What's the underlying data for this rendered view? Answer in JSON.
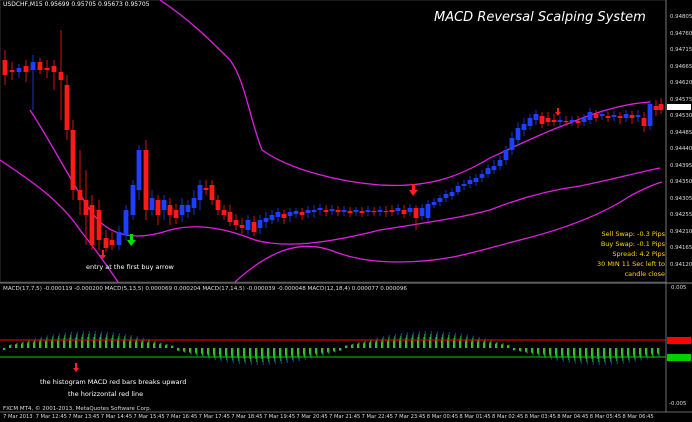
{
  "chart": {
    "symbol_header": "USDCHF,M15  0.95699 0.95705 0.95673 0.95705",
    "title": "MACD Reversal Scalping System",
    "info_lines": [
      "Sell Swap: -0.3 Pips",
      "Buy Swap: -0.1 Pips",
      "Spread: 4.2 Pips",
      "30 MIN 11 Sec left to candle close"
    ],
    "annotation_entry": "entry at the first buy arrow",
    "price_ticks": [
      "0.94805",
      "0.94760",
      "0.94715",
      "0.94665",
      "0.94620",
      "0.94575",
      "0.94530",
      "0.94485",
      "0.94440",
      "0.94395",
      "0.94350",
      "0.94305",
      "0.94255",
      "0.94210",
      "0.94165",
      "0.94120"
    ],
    "colors": {
      "bull": "#1f3fff",
      "bear": "#ff1a1a",
      "envelope": "#e020e0",
      "macd_line_red": "#ff0000",
      "macd_line_green": "#00d000"
    }
  },
  "macd": {
    "header": "MACD(17,7,5) -0.000119 -0.000200  MACD(5,13,5) 0.000069 0.000204  MACD(17,14,5) -0.000039 -0.000048  MACD(12,18,4) 0.000077 0.000096",
    "annotation_line1": "the histogram MACD red bars breaks upward",
    "annotation_line2": "the horizzontal red line",
    "ticks": [
      "0.005",
      "-0.005"
    ]
  },
  "time_axis": [
    "7 Mar 2013",
    "7 Mar 12:45",
    "7 Mar 13:45",
    "7 Mar 14:45",
    "7 Mar 15:45",
    "7 Mar 16:45",
    "7 Mar 17:45",
    "7 Mar 18:45",
    "7 Mar 19:45",
    "7 Mar 20:45",
    "7 Mar 21:45",
    "7 Mar 22:45",
    "7 Mar 23:45",
    "8 Mar 00:45",
    "8 Mar 01:45",
    "8 Mar 02:45",
    "8 Mar 03:45",
    "8 Mar 04:45",
    "8 Mar 05:45",
    "8 Mar 06:45"
  ],
  "footer": {
    "copyright": "FXCM MT4, © 2001-2013, MetaQuotes Software Corp."
  }
}
